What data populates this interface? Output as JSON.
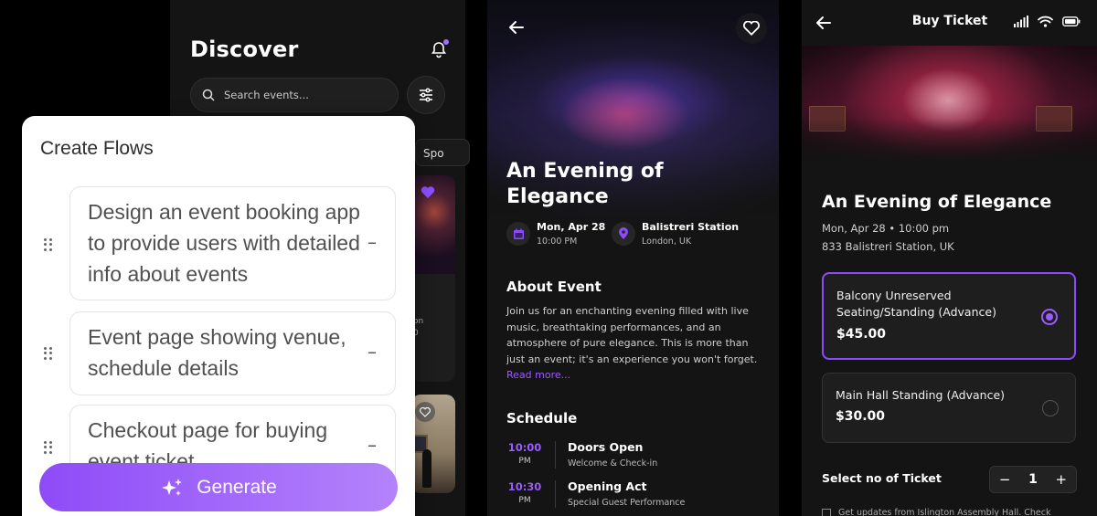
{
  "discover": {
    "title": "Discover",
    "search_placeholder": "Search events...",
    "category_chip": "Spo",
    "card_text_1": "on",
    "card_text_2": "0"
  },
  "flows": {
    "title": "Create Flows",
    "items": [
      "Design an event booking app to provide users with detailed info about events",
      "Event page showing venue, schedule details",
      "Checkout page for buying event ticket"
    ],
    "remove_symbol": "–",
    "generate_label": "Generate"
  },
  "event": {
    "title": "An Evening of Elegance",
    "date": "Mon, Apr 28",
    "time": "10:00 PM",
    "venue": "Balistreri Station",
    "location": "London, UK",
    "about_heading": "About Event",
    "about_text": "Join us for an enchanting evening filled with live music, breathtaking performances, and an atmosphere of pure elegance. This is more than just an event; it's an experience you won't forget.",
    "read_more": "Read more...",
    "schedule_heading": "Schedule",
    "schedule": [
      {
        "hour": "10:00",
        "period": "PM",
        "title": "Doors Open",
        "subtitle": "Welcome & Check-in"
      },
      {
        "hour": "10:30",
        "period": "PM",
        "title": "Opening Act",
        "subtitle": "Special Guest Performance"
      }
    ]
  },
  "buy": {
    "header_title": "Buy Ticket",
    "title": "An Evening of Elegance",
    "datetime": "Mon, Apr 28 • 10:00 pm",
    "address": "833 Balistreri Station, UK",
    "tickets": [
      {
        "name": "Balcony Unreserved Seating/Standing (Advance)",
        "price": "$45.00",
        "selected": true
      },
      {
        "name": "Main Hall Standing (Advance)",
        "price": "$30.00",
        "selected": false
      }
    ],
    "quantity_label": "Select no of Ticket",
    "quantity": "1",
    "minus": "−",
    "plus": "+",
    "updates_text": "Get updates from Islington Assembly Hall. Check"
  },
  "colors": {
    "accent": "#8d4bff",
    "panel_bg": "#141414",
    "generate_gradient_start": "#8e4bf8",
    "generate_gradient_end": "#b483fb"
  }
}
